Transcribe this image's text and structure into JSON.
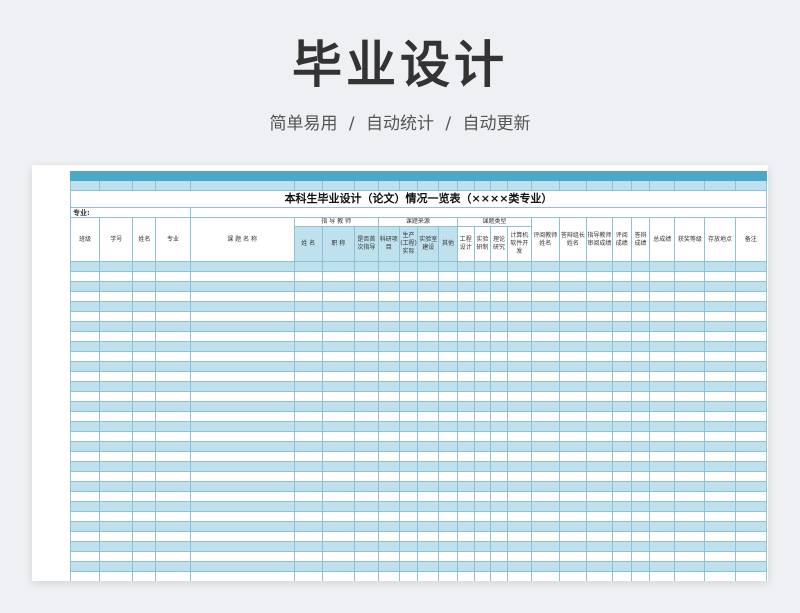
{
  "header": {
    "title": "毕业设计",
    "subtitle": "简单易用 / 自动统计 / 自动更新"
  },
  "sheet": {
    "table_title": "本科生毕业设计（论文）情况一览表（××××类专业）",
    "major_label": "专业:",
    "group_headers": {
      "advisor": "指 导 教 师",
      "topic_source": "课题来源",
      "topic_type": "课题类型"
    },
    "columns": {
      "class": "班级",
      "student_id": "学号",
      "name": "姓名",
      "major": "专业",
      "topic_name": "课 题 名 称",
      "advisor_name": "姓 名",
      "advisor_title": "职 称",
      "first_time_advisor": "是否首次指导",
      "research_project": "科研项目",
      "production_practice": "生产(工程)实际",
      "lab_construction": "实验室建设",
      "other": "其他",
      "engineering_design": "工程设计",
      "experimental_research": "实验研制",
      "theoretical_research": "理论研究",
      "software_dev": "计算机软件开发",
      "reviewer_name": "评阅教师姓名",
      "defense_leader_name": "答辩组长姓名",
      "advisor_review_score": "指导教师审阅成绩",
      "review_score": "评阅成绩",
      "defense_score": "答辩成绩",
      "total_score": "总成绩",
      "award_level": "获奖等级",
      "storage_location": "存放地点",
      "remarks": "备注"
    }
  },
  "colors": {
    "accent": "#4aa9c9",
    "light_row": "#bfe1ee",
    "border": "#8fc1d4"
  }
}
